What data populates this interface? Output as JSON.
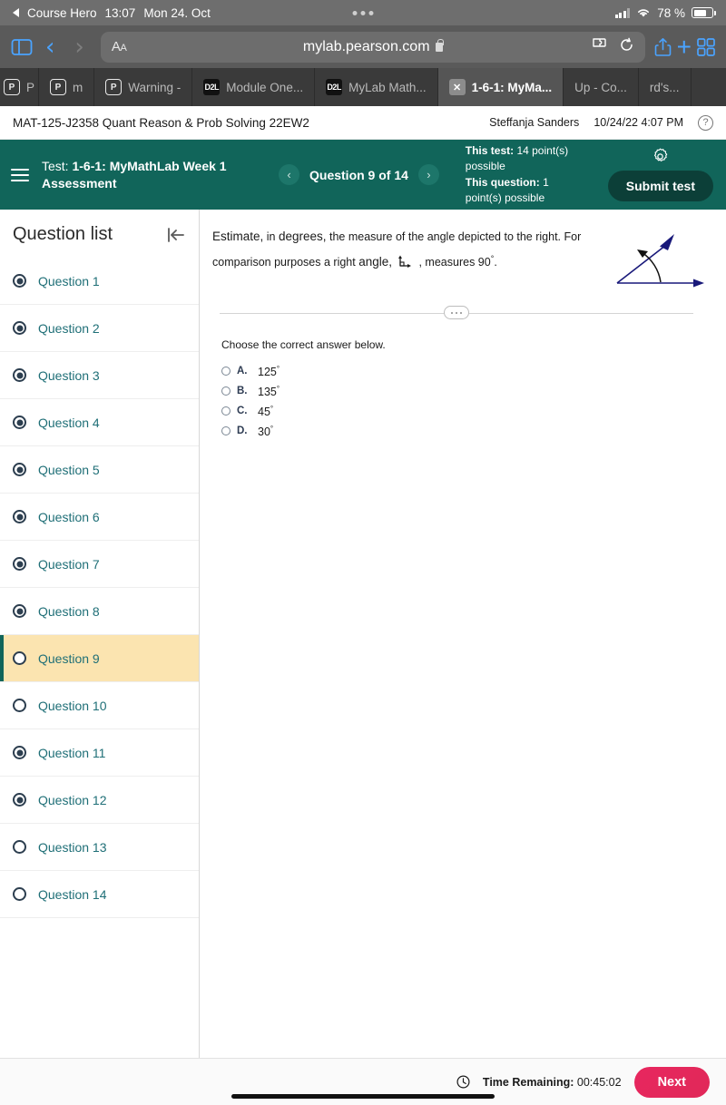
{
  "status_bar": {
    "back_app": "Course Hero",
    "time": "13:07",
    "date": "Mon 24. Oct",
    "battery_percent": "78 %"
  },
  "browser": {
    "url": "mylab.pearson.com",
    "aa_label": "AA",
    "icons": {
      "sidebar": "sidebar-icon",
      "back": "back-chevron-icon",
      "forward": "forward-chevron-icon",
      "extensions": "extensions-puzzle-icon",
      "reload": "reload-icon",
      "share": "share-icon",
      "new_tab": "plus-icon",
      "tab_overview": "tab-grid-icon",
      "lock": "lock-icon"
    },
    "tabs": [
      {
        "label": "P",
        "icon": "pearson-icon",
        "active": false,
        "sliver": true
      },
      {
        "label": "m",
        "icon": "pearson-icon",
        "active": false,
        "sliver": false
      },
      {
        "label": "Warning -",
        "icon": "pearson-icon",
        "active": false,
        "sliver": false
      },
      {
        "label": "Module One...",
        "icon": "d2l-icon",
        "active": false,
        "sliver": false
      },
      {
        "label": "MyLab Math...",
        "icon": "d2l-icon",
        "active": false,
        "sliver": false
      },
      {
        "label": "1-6-1: MyMa...",
        "icon": "close-icon",
        "active": true,
        "sliver": false
      },
      {
        "label": "Up - Co...",
        "icon": "none",
        "active": false,
        "sliver": false
      },
      {
        "label": "rd's...",
        "icon": "none",
        "active": false,
        "sliver": false
      }
    ]
  },
  "course_bar": {
    "course": "MAT-125-J2358 Quant Reason & Prob Solving 22EW2",
    "student": "Steffanja Sanders",
    "timestamp": "10/24/22 4:07 PM",
    "help_label": "?"
  },
  "test_header": {
    "test_prefix": "Test:",
    "test_title": "1-6-1: MyMathLab Week 1 Assessment",
    "prev_label": "‹",
    "next_label": "›",
    "question_counter": "Question 9 of 14",
    "this_test_label": "This test:",
    "this_test_value": "14 point(s) possible",
    "this_question_label": "This question:",
    "this_question_value": "1 point(s) possible",
    "submit_label": "Submit test",
    "accent_color": "#11655a"
  },
  "question_list": {
    "title": "Question list",
    "collapse_icon": "collapse-panel-icon",
    "items": [
      {
        "label": "Question 1",
        "answered": true,
        "current": false
      },
      {
        "label": "Question 2",
        "answered": true,
        "current": false
      },
      {
        "label": "Question 3",
        "answered": true,
        "current": false
      },
      {
        "label": "Question 4",
        "answered": true,
        "current": false
      },
      {
        "label": "Question 5",
        "answered": true,
        "current": false
      },
      {
        "label": "Question 6",
        "answered": true,
        "current": false
      },
      {
        "label": "Question 7",
        "answered": true,
        "current": false
      },
      {
        "label": "Question 8",
        "answered": true,
        "current": false
      },
      {
        "label": "Question 9",
        "answered": false,
        "current": true
      },
      {
        "label": "Question 10",
        "answered": false,
        "current": false
      },
      {
        "label": "Question 11",
        "answered": true,
        "current": false
      },
      {
        "label": "Question 12",
        "answered": true,
        "current": false
      },
      {
        "label": "Question 13",
        "answered": false,
        "current": false
      },
      {
        "label": "Question 14",
        "answered": false,
        "current": false
      }
    ]
  },
  "question": {
    "line1_a": "Estimate,",
    "line1_b": " in ",
    "line1_c": "degrees,",
    "line1_d": " the measure of the angle depicted to the right. For",
    "line2_a": "comparison purposes a right ",
    "line2_b": "angle,",
    "line2_c": ", measures 90",
    "line2_deg": "°",
    "line2_end": ".",
    "figure_name": "angle-diagram",
    "right_angle_icon": "right-angle-icon",
    "choose_label": "Choose the correct answer below.",
    "choices": [
      {
        "letter": "A.",
        "value": "125",
        "degree": "°"
      },
      {
        "letter": "B.",
        "value": "135",
        "degree": "°"
      },
      {
        "letter": "C.",
        "value": "45",
        "degree": "°"
      },
      {
        "letter": "D.",
        "value": "30",
        "degree": "°"
      }
    ]
  },
  "bottom_bar": {
    "clock_icon": "clock-icon",
    "time_label": "Time Remaining:",
    "time_value": "00:45:02",
    "next_label": "Next",
    "next_color": "#e5275c"
  }
}
